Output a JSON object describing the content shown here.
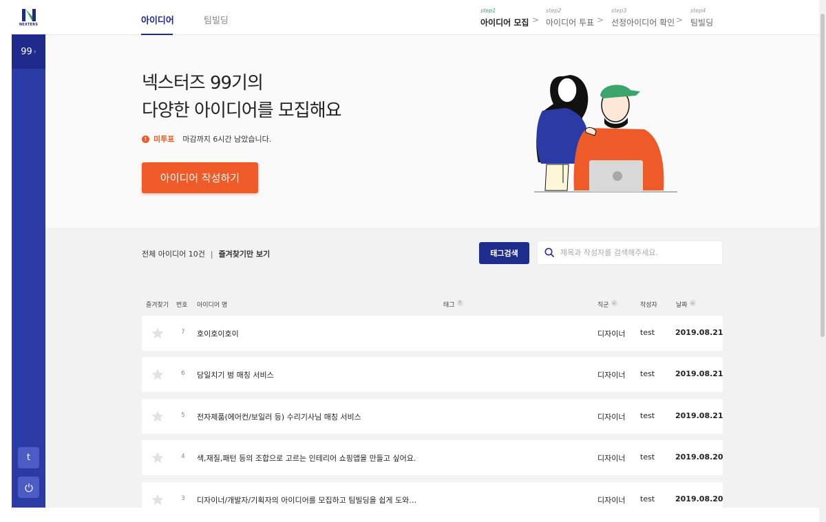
{
  "brand": {
    "name": "NEXTERS"
  },
  "sidebar": {
    "generation": "99",
    "bottom_button_t": "t"
  },
  "nav": {
    "tabs": [
      {
        "label": "아이디어"
      },
      {
        "label": "팀빌딩"
      }
    ],
    "steps": [
      {
        "num": "step1",
        "label": "아이디어 모집"
      },
      {
        "num": "step2",
        "label": "아이디어 투표"
      },
      {
        "num": "step3",
        "label": "선정아이디어 확인"
      },
      {
        "num": "step4",
        "label": "팀빌딩"
      }
    ],
    "step_separator": ">"
  },
  "hero": {
    "title_line1": "넥스터즈 99기의",
    "title_line2": "다양한 아이디어를 모집해요",
    "status_badge": "미투표",
    "status_message": "마감까지 6시간 남았습니다.",
    "cta_label": "아이디어 작성하기"
  },
  "list": {
    "summary_total": "전체 아이디어 10건",
    "summary_separator": "|",
    "favorites_only": "즐겨찾기만 보기",
    "tag_search_label": "태그검색",
    "search_placeholder": "제목과 작성자를 검색해주세요.",
    "columns": {
      "favorite": "즐겨찾기",
      "number": "번호",
      "idea_name": "아이디어 명",
      "tag": "태그",
      "job": "직군",
      "author": "작성자",
      "date": "날짜"
    },
    "rows": [
      {
        "num": "7",
        "title": "호이호이호이",
        "job": "디자이너",
        "author": "test",
        "date": "2019.08.21"
      },
      {
        "num": "6",
        "title": "당일치기 벙 매칭 서비스",
        "job": "디자이너",
        "author": "test",
        "date": "2019.08.21"
      },
      {
        "num": "5",
        "title": "전자제품(에어컨/보일러 등) 수리기사님 매칭 서비스",
        "job": "디자이너",
        "author": "test",
        "date": "2019.08.21"
      },
      {
        "num": "4",
        "title": "색,재질,패턴 등의 조합으로 고르는 인테리어 쇼핑앱을 만들고 싶어요.",
        "job": "디자이너",
        "author": "test",
        "date": "2019.08.20"
      },
      {
        "num": "3",
        "title": "디자이너/개발자/기획자의 아이디어를 모집하고 팀빌딩을 쉽게 도와…",
        "job": "디자이너",
        "author": "test",
        "date": "2019.08.20"
      }
    ]
  },
  "colors": {
    "primary": "#2b3ba6",
    "accent": "#ee5a28",
    "navy": "#1e2d8c",
    "background": "#f2f2f2"
  },
  "icons": {
    "logo": "nexters-logo-icon",
    "info": "info-icon",
    "alert": "alert-icon",
    "search": "search-icon",
    "star": "star-icon",
    "power": "power-icon",
    "sort": "chevron-down-icon"
  }
}
